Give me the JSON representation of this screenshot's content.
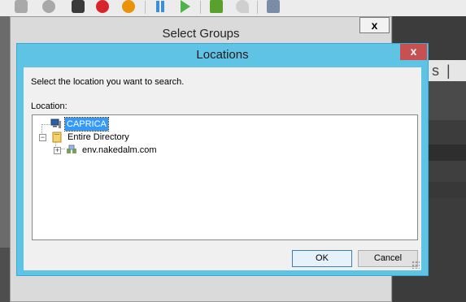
{
  "toolbar": {
    "icons": [
      "connect-icon",
      "power-icon",
      "stop-icon",
      "shutdown-icon",
      "power-off-icon",
      "pause-icon",
      "play-icon",
      "run-script-icon",
      "undo-icon",
      "network-icon"
    ]
  },
  "host": {
    "tab_fragment": "s | s"
  },
  "select_groups": {
    "title": "Select Groups",
    "close_label": "x"
  },
  "locations_dialog": {
    "title": "Locations",
    "close_label": "x",
    "instruction": "Select the location you want to search.",
    "location_label": "Location:",
    "tree": [
      {
        "label": "CAPRICA",
        "icon": "computer-icon",
        "selected": true
      },
      {
        "label": "Entire Directory",
        "icon": "directory-icon",
        "expanded": true
      },
      {
        "label": "env.nakedalm.com",
        "icon": "domain-icon",
        "expanded": false
      }
    ],
    "ok_label": "OK",
    "cancel_label": "Cancel"
  },
  "colors": {
    "titlebar_active": "#5fc3e6",
    "close_button": "#c75050",
    "selection": "#3399ff"
  }
}
